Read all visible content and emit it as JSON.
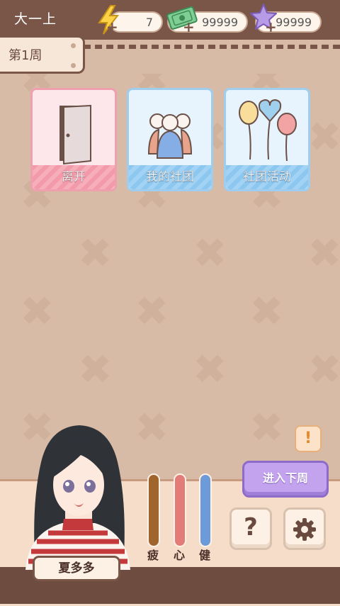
{
  "header": {
    "semester": "大一上",
    "energy": {
      "value": "7",
      "icon": "lightning-icon"
    },
    "money": {
      "value": "99999",
      "icon": "banknote-icon"
    },
    "stars": {
      "value": "99999",
      "icon": "star-icon"
    },
    "plus": "+"
  },
  "week_label": "第1周",
  "cards": [
    {
      "label": "离开",
      "icon": "door-icon"
    },
    {
      "label": "我的社团",
      "icon": "club-members-icon"
    },
    {
      "label": "社团活动",
      "icon": "balloons-icon"
    }
  ],
  "character": {
    "name": "夏多多"
  },
  "stats": [
    {
      "label": "疲",
      "color": "#a0652c"
    },
    {
      "label": "心",
      "color": "#e27c78"
    },
    {
      "label": "健",
      "color": "#6d9ad8"
    }
  ],
  "alert_symbol": "!",
  "next_week_label": "进入下周",
  "help_symbol": "?",
  "colors": {
    "topbar": "#7a5648",
    "background": "#d8bba6",
    "next_button": "#c3a3ee"
  }
}
